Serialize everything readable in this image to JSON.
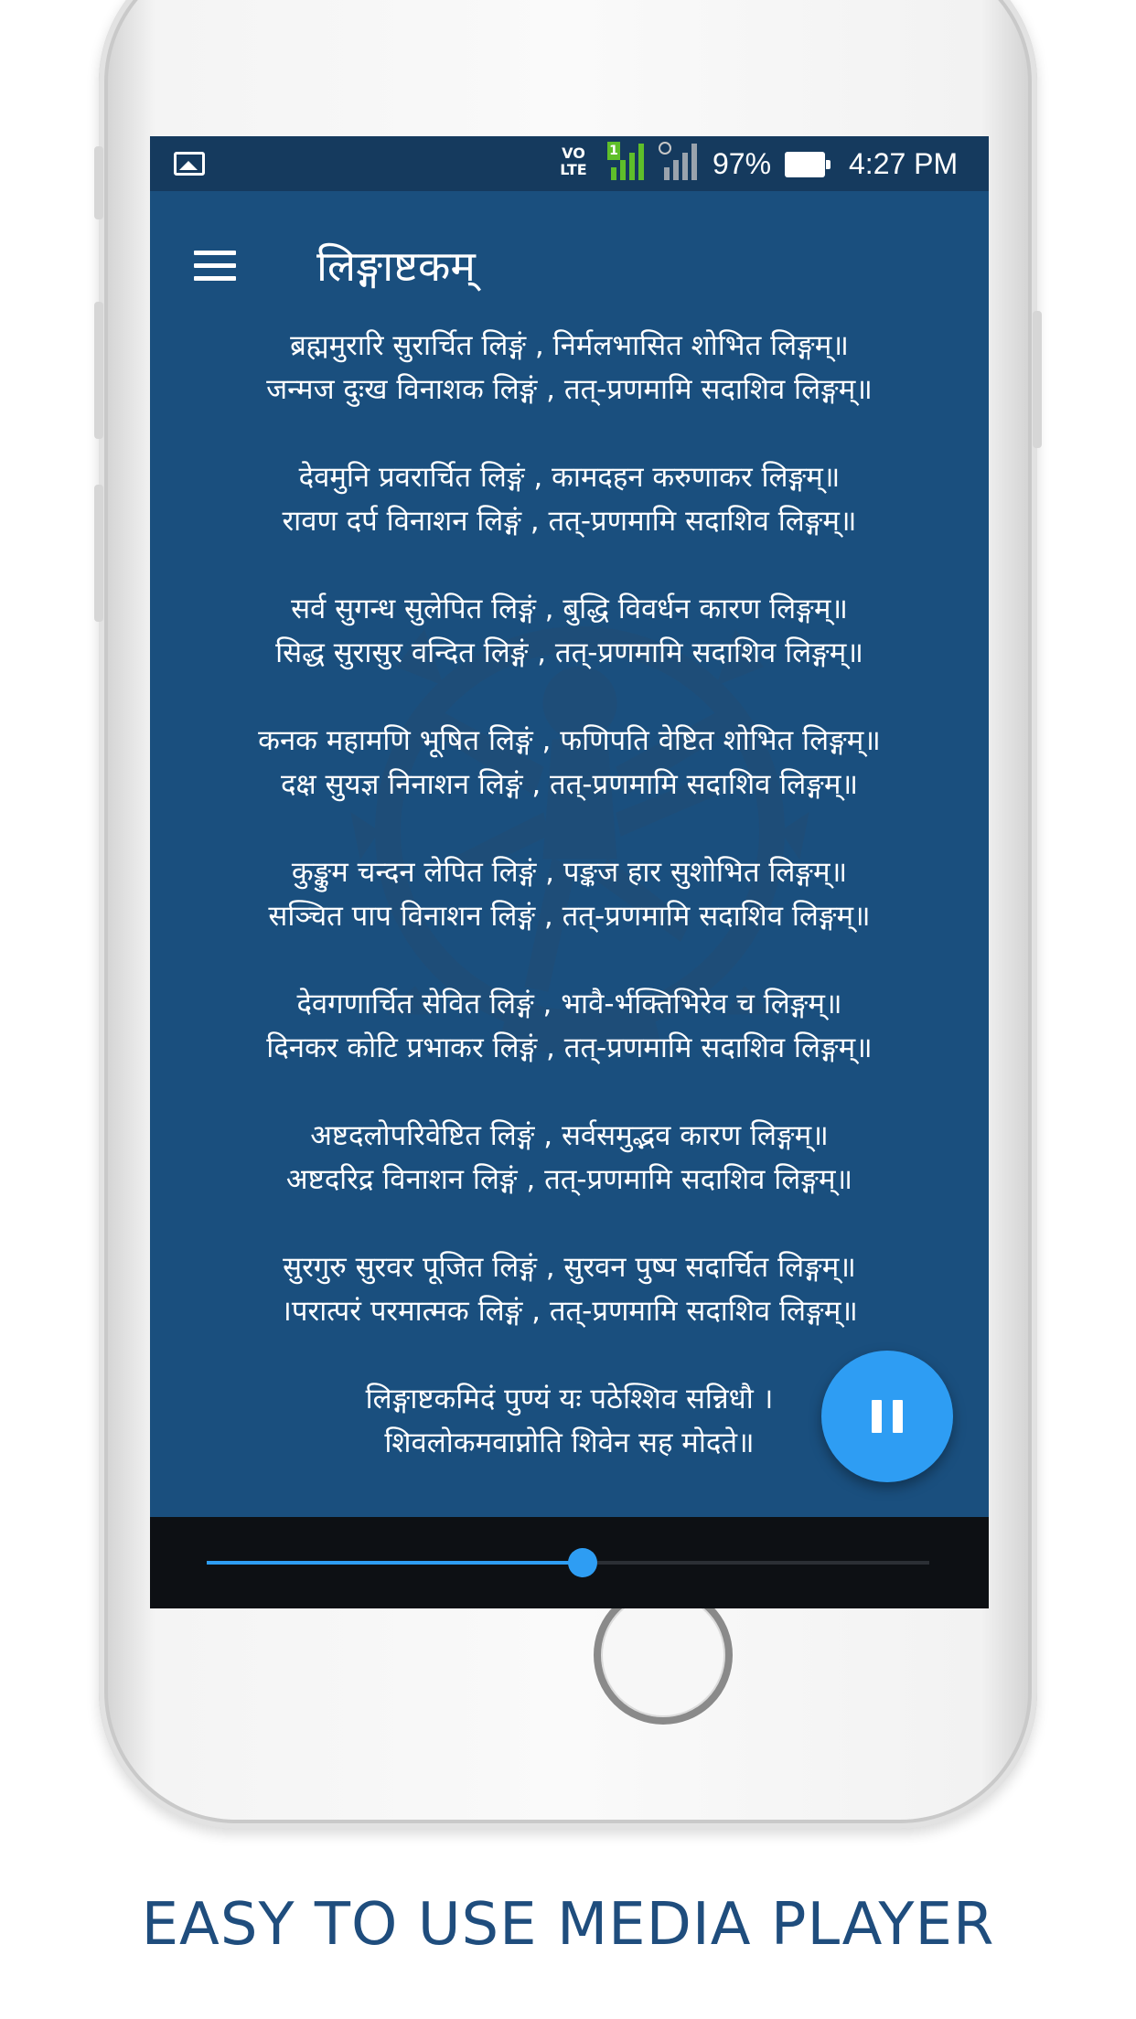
{
  "status_bar": {
    "image_icon": "image-icon",
    "volte_label": "VO\nLTE",
    "sim1_label": "1",
    "battery_percent": "97%",
    "time": "4:27 PM"
  },
  "app_bar": {
    "menu_icon": "hamburger-menu-icon",
    "title": "लिङ्गाष्टकम्"
  },
  "lyrics": [
    [
      "ब्रह्ममुरारि सुरार्चित लिङ्गं , निर्मलभासित शोभित लिङ्गम्॥",
      "जन्मज दुःख विनाशक लिङ्गं , तत्-प्रणमामि सदाशिव लिङ्गम्॥"
    ],
    [
      "देवमुनि प्रवरार्चित लिङ्गं , कामदहन करुणाकर लिङ्गम्॥",
      "रावण दर्प विनाशन लिङ्गं , तत्-प्रणमामि सदाशिव लिङ्गम्॥"
    ],
    [
      "सर्व सुगन्ध सुलेपित लिङ्गं , बुद्धि विवर्धन कारण लिङ्गम्॥",
      "सिद्ध सुरासुर वन्दित लिङ्गं , तत्-प्रणमामि सदाशिव लिङ्गम्॥"
    ],
    [
      "कनक महामणि भूषित लिङ्गं , फणिपति वेष्टित शोभित लिङ्गम्॥",
      "दक्ष सुयज्ञ निनाशन लिङ्गं , तत्-प्रणमामि सदाशिव लिङ्गम्॥"
    ],
    [
      "कुङ्कुम चन्दन लेपित लिङ्गं , पङ्कज हार सुशोभित लिङ्गम्॥",
      "सञ्चित पाप विनाशन लिङ्गं , तत्-प्रणमामि सदाशिव लिङ्गम्॥"
    ],
    [
      "देवगणार्चित सेवित लिङ्गं , भावै-र्भक्तिभिरेव च लिङ्गम्॥",
      "दिनकर कोटि प्रभाकर लिङ्गं , तत्-प्रणमामि सदाशिव लिङ्गम्॥"
    ],
    [
      "अष्टदलोपरिवेष्टित लिङ्गं , सर्वसमुद्भव कारण लिङ्गम्॥",
      "अष्टदरिद्र विनाशन लिङ्गं , तत्-प्रणमामि सदाशिव लिङ्गम्॥"
    ],
    [
      "सुरगुरु सुरवर पूजित लिङ्गं , सुरवन पुष्प सदार्चित लिङ्गम्॥",
      "।परात्परं परमात्मक लिङ्गं , तत्-प्रणमामि सदाशिव लिङ्गम्॥"
    ],
    [
      "लिङ्गाष्टकमिदं पुण्यं यः पठेश्शिव सन्निधौ ।",
      "शिवलोकमवाप्नोति शिवेन सह मोदते॥"
    ]
  ],
  "player": {
    "pause_icon": "pause-icon",
    "progress_fraction": 0.52,
    "accent_color": "#2e9df3"
  },
  "caption": "EASY TO USE MEDIA PLAYER",
  "colors": {
    "screen_bg": "#1a4f7e",
    "status_bg": "#153a5e",
    "player_bg": "#0d1014",
    "caption": "#1f4d7d"
  }
}
